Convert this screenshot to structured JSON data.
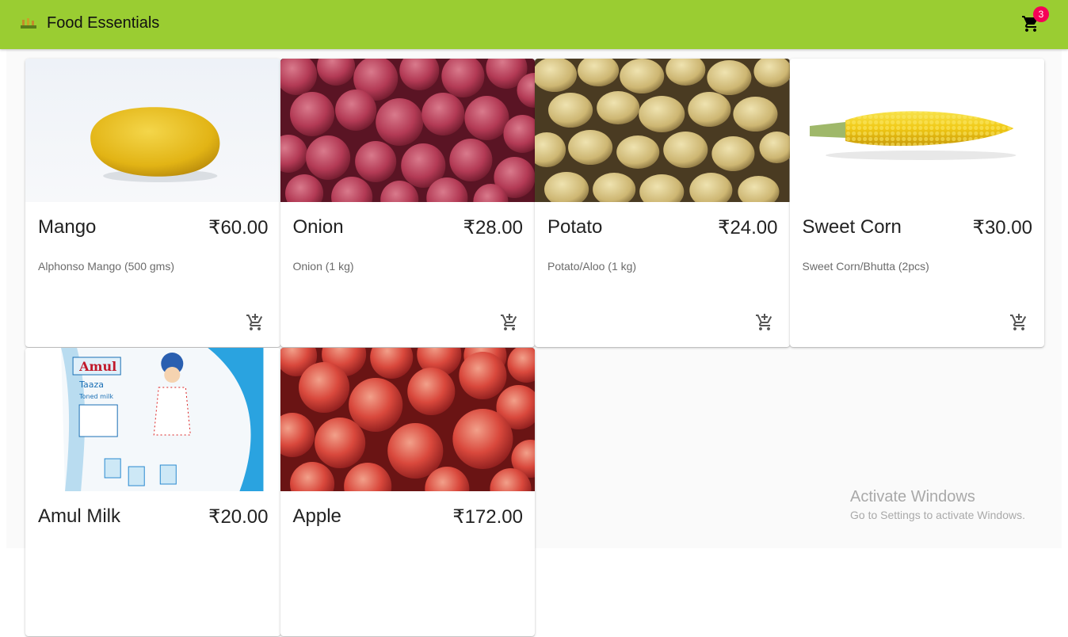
{
  "app": {
    "title": "Food Essentials",
    "logo_icon": "store-logo-icon",
    "cart_icon": "shopping-cart-icon",
    "cart_count": "3",
    "brand_color": "#9acd32",
    "badge_color": "#f50057"
  },
  "products": [
    {
      "name": "Mango",
      "price": "₹60.00",
      "description": "Alphonso Mango (500 gms)",
      "image": "mango",
      "add_icon": "add-shopping-cart-icon"
    },
    {
      "name": "Onion",
      "price": "₹28.00",
      "description": "Onion (1 kg)",
      "image": "red onions",
      "add_icon": "add-shopping-cart-icon"
    },
    {
      "name": "Potato",
      "price": "₹24.00",
      "description": "Potato/Aloo (1 kg)",
      "image": "potatoes",
      "add_icon": "add-shopping-cart-icon"
    },
    {
      "name": "Sweet Corn",
      "price": "₹30.00",
      "description": "Sweet Corn/Bhutta (2pcs)",
      "image": "corn cob",
      "add_icon": "add-shopping-cart-icon"
    },
    {
      "name": "Amul Milk",
      "price": "₹20.00",
      "description": "",
      "image": "milk pouch",
      "add_icon": "add-shopping-cart-icon",
      "package_text": {
        "brand": "Amul",
        "line1": "Taaza",
        "line2": "Toned milk"
      }
    },
    {
      "name": "Apple",
      "price": "₹172.00",
      "description": "",
      "image": "red apples",
      "add_icon": "add-shopping-cart-icon"
    }
  ],
  "watermark": {
    "title": "Activate Windows",
    "subtitle": "Go to Settings to activate Windows."
  }
}
